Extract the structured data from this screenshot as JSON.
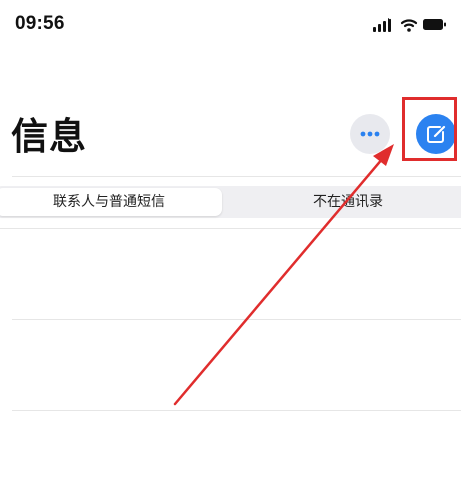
{
  "status_bar": {
    "time": "09:56"
  },
  "header": {
    "title": "信息"
  },
  "segments": {
    "left_label": "联系人与普通短信",
    "right_label": "不在通讯录",
    "selected": "联系人与普通短信"
  },
  "colors": {
    "accent": "#2b82f0",
    "annotation": "#e02d2d"
  },
  "icons": {
    "more": "ellipsis-icon",
    "compose": "compose-icon",
    "signal": "signal-icon",
    "wifi": "wifi-icon",
    "battery": "battery-icon"
  }
}
